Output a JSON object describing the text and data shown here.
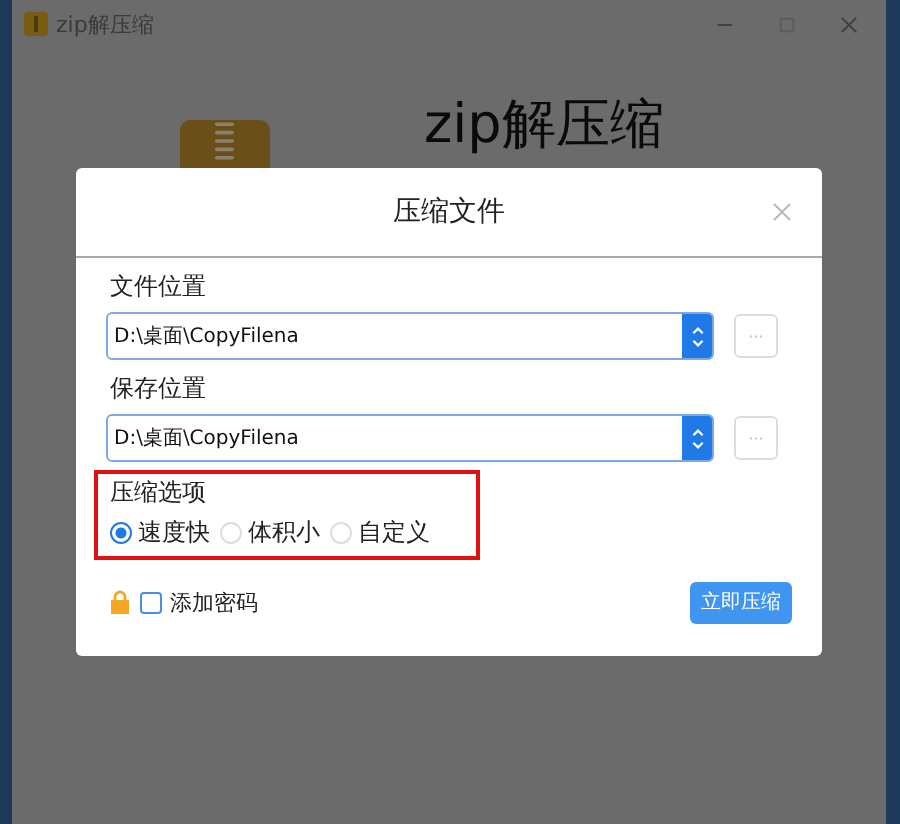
{
  "window": {
    "title": "zip解压缩"
  },
  "app": {
    "heading": "zip解压缩"
  },
  "dialog": {
    "title": "压缩文件",
    "fields": [
      {
        "label": "文件位置",
        "value": "D:\\桌面\\CopyFilena",
        "browse": "···"
      },
      {
        "label": "保存位置",
        "value": "D:\\桌面\\CopyFilena",
        "browse": "···"
      }
    ],
    "options_label": "压缩选项",
    "options": [
      {
        "label": "速度快",
        "selected": true
      },
      {
        "label": "体积小",
        "selected": false
      },
      {
        "label": "自定义",
        "selected": false
      }
    ],
    "password": {
      "label": "添加密码",
      "checked": false
    },
    "submit": "立即压缩"
  }
}
